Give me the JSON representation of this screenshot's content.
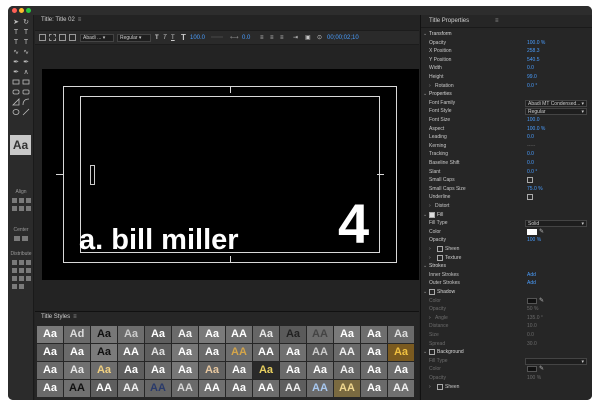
{
  "title_panel": {
    "tab_label": "Title: Title 02"
  },
  "toolbar": {
    "font_family": "Abadi ...",
    "font_style": "Regular",
    "size_glyph_small": "T",
    "size_glyph": "T",
    "font_size": "100.0",
    "tracking": "0.0",
    "timecode": "00;00;02;10"
  },
  "canvas": {
    "caption": "a. bill miller",
    "number": "4"
  },
  "tools": {
    "aa_label": "Aa",
    "align_label": "Align",
    "center_label": "Center",
    "distribute_label": "Distribute"
  },
  "styles": {
    "tab_label": "Title Styles",
    "swatches": [
      {
        "text": "Aa",
        "bg": "#7a7a7a",
        "fg": "#ffffff"
      },
      {
        "text": "Ad",
        "bg": "#6a6a6a",
        "fg": "#dddddd"
      },
      {
        "text": "Aa",
        "bg": "#777777",
        "fg": "#111111"
      },
      {
        "text": "Aa",
        "bg": "#6d6d6d",
        "fg": "#cccccc"
      },
      {
        "text": "Aa",
        "bg": "#5e5e5e",
        "fg": "#ffffff"
      },
      {
        "text": "Aa",
        "bg": "#6a6a6a",
        "fg": "#f5f5f5"
      },
      {
        "text": "Aa",
        "bg": "#7a7a7a",
        "fg": "#ffffff"
      },
      {
        "text": "AA",
        "bg": "#707070",
        "fg": "#ffffff"
      },
      {
        "text": "Aa",
        "bg": "#666666",
        "fg": "#e8e8e8"
      },
      {
        "text": "Aa",
        "bg": "#5a5a5a",
        "fg": "#222222"
      },
      {
        "text": "AA",
        "bg": "#6d6d6d",
        "fg": "#444444"
      },
      {
        "text": "Aa",
        "bg": "#7a7a7a",
        "fg": "#ffffff"
      },
      {
        "text": "Aa",
        "bg": "#6e6e6e",
        "fg": "#ffffff"
      },
      {
        "text": "Aa",
        "bg": "#6a6a6a",
        "fg": "#dddddd"
      },
      {
        "text": "Aa",
        "bg": "#5a5a5a",
        "fg": "#ffffff"
      },
      {
        "text": "Aa",
        "bg": "#6a6a6a",
        "fg": "#ffffff"
      },
      {
        "text": "Aa",
        "bg": "#7b7b7b",
        "fg": "#111111"
      },
      {
        "text": "AA",
        "bg": "#6a6a6a",
        "fg": "#ffffff"
      },
      {
        "text": "Aa",
        "bg": "#5e5e5e",
        "fg": "#e0e0e0"
      },
      {
        "text": "Aa",
        "bg": "#777777",
        "fg": "#ffffff"
      },
      {
        "text": "Aa",
        "bg": "#6a6a6a",
        "fg": "#ffffff"
      },
      {
        "text": "AA",
        "bg": "#6e6e6e",
        "fg": "#d4a54a"
      },
      {
        "text": "AA",
        "bg": "#666666",
        "fg": "#ffffff"
      },
      {
        "text": "Aa",
        "bg": "#707070",
        "fg": "#ffffff"
      },
      {
        "text": "AA",
        "bg": "#5d5d5d",
        "fg": "#cccccc"
      },
      {
        "text": "AA",
        "bg": "#6a6a6a",
        "fg": "#eeeeee"
      },
      {
        "text": "Aa",
        "bg": "#6a6a6a",
        "fg": "#ffffff"
      },
      {
        "text": "Aa",
        "bg": "#7a5a20",
        "fg": "#f0c040"
      },
      {
        "text": "Aa",
        "bg": "#6a6a6a",
        "fg": "#ffffff"
      },
      {
        "text": "Aa",
        "bg": "#707070",
        "fg": "#e8e8e8"
      },
      {
        "text": "Aa",
        "bg": "#6d6d6d",
        "fg": "#f0d080"
      },
      {
        "text": "Aa",
        "bg": "#5e5e5e",
        "fg": "#ffffff"
      },
      {
        "text": "Aa",
        "bg": "#6a6a6a",
        "fg": "#ffffff"
      },
      {
        "text": "Aa",
        "bg": "#777777",
        "fg": "#ffffff"
      },
      {
        "text": "Aa",
        "bg": "#606060",
        "fg": "#e8c8a0"
      },
      {
        "text": "Aa",
        "bg": "#6d6d6d",
        "fg": "#ffffff"
      },
      {
        "text": "Aa",
        "bg": "#2a2a2a",
        "fg": "#e8d060"
      },
      {
        "text": "Aa",
        "bg": "#6a6a6a",
        "fg": "#ffffff"
      },
      {
        "text": "Aa",
        "bg": "#707070",
        "fg": "#ffffff"
      },
      {
        "text": "Aa",
        "bg": "#666666",
        "fg": "#f0f0f0"
      },
      {
        "text": "Aa",
        "bg": "#6a6a6a",
        "fg": "#ffffff"
      },
      {
        "text": "Aa",
        "bg": "#6d6d6d",
        "fg": "#ffffff"
      },
      {
        "text": "Aa",
        "bg": "#6a6a6a",
        "fg": "#ffffff"
      },
      {
        "text": "AA",
        "bg": "#707070",
        "fg": "#111111"
      },
      {
        "text": "AA",
        "bg": "#5e5e5e",
        "fg": "#ffffff"
      },
      {
        "text": "AA",
        "bg": "#6a6a6a",
        "fg": "#f0f0f0"
      },
      {
        "text": "AA",
        "bg": "#666666",
        "fg": "#2a3a6a"
      },
      {
        "text": "AA",
        "bg": "#6a6a6a",
        "fg": "#d8d8d8"
      },
      {
        "text": "AA",
        "bg": "#707070",
        "fg": "#ffffff"
      },
      {
        "text": "Aa",
        "bg": "#6a6a6a",
        "fg": "#ffffff"
      },
      {
        "text": "AA",
        "bg": "#6d6d6d",
        "fg": "#ffffff"
      },
      {
        "text": "AA",
        "bg": "#5e5e5e",
        "fg": "#eeeeee"
      },
      {
        "text": "AA",
        "bg": "#6a6a6a",
        "fg": "#a8c8f0"
      },
      {
        "text": "AA",
        "bg": "#7a6a40",
        "fg": "#f0d890"
      },
      {
        "text": "Aa",
        "bg": "#6a6a6a",
        "fg": "#ffffff"
      },
      {
        "text": "AA",
        "bg": "#707070",
        "fg": "#f0f0f0"
      }
    ]
  },
  "properties": {
    "title": "Title Properties",
    "rows": [
      {
        "kind": "section",
        "label": "Transform",
        "chev": "⌄"
      },
      {
        "kind": "value",
        "label": "Opacity",
        "value": "100.0 %"
      },
      {
        "kind": "value",
        "label": "X Position",
        "value": "258.3"
      },
      {
        "kind": "value",
        "label": "Y Position",
        "value": "540.5"
      },
      {
        "kind": "value",
        "label": "Width",
        "value": "0.0"
      },
      {
        "kind": "value",
        "label": "Height",
        "value": "99.0"
      },
      {
        "kind": "value",
        "label": "Rotation",
        "value": "0.0 °",
        "chev": "›"
      },
      {
        "kind": "section",
        "label": "Properties",
        "chev": "⌄"
      },
      {
        "kind": "select",
        "label": "Font Family",
        "value": "Abadi MT Condensed..."
      },
      {
        "kind": "select",
        "label": "Font Style",
        "value": "Regular"
      },
      {
        "kind": "value",
        "label": "Font Size",
        "value": "100.0"
      },
      {
        "kind": "value",
        "label": "Aspect",
        "value": "100.0 %"
      },
      {
        "kind": "value",
        "label": "Leading",
        "value": "0.0"
      },
      {
        "kind": "dim",
        "label": "Kerning",
        "value": "-----"
      },
      {
        "kind": "value",
        "label": "Tracking",
        "value": "0.0"
      },
      {
        "kind": "value",
        "label": "Baseline Shift",
        "value": "0.0"
      },
      {
        "kind": "value",
        "label": "Slant",
        "value": "0.0 °"
      },
      {
        "kind": "check",
        "label": "Small Caps",
        "checked": false
      },
      {
        "kind": "value",
        "label": "Small Caps Size",
        "value": "75.0 %"
      },
      {
        "kind": "check",
        "label": "Underline",
        "checked": false
      },
      {
        "kind": "plain",
        "label": "Distort",
        "chev": "›"
      },
      {
        "kind": "sectioncheck",
        "label": "Fill",
        "chev": "⌄",
        "checked": true
      },
      {
        "kind": "select",
        "label": "Fill Type",
        "value": "Solid"
      },
      {
        "kind": "color",
        "label": "Color",
        "color": "#ffffff"
      },
      {
        "kind": "value",
        "label": "Opacity",
        "value": "100 %"
      },
      {
        "kind": "subcheck",
        "label": "Sheen",
        "chev": "›",
        "checked": false
      },
      {
        "kind": "subcheck",
        "label": "Texture",
        "chev": "›",
        "checked": false
      },
      {
        "kind": "section",
        "label": "Strokes",
        "chev": "⌄"
      },
      {
        "kind": "add",
        "label": "Inner Strokes",
        "add": "Add"
      },
      {
        "kind": "add",
        "label": "Outer Strokes",
        "add": "Add"
      },
      {
        "kind": "sectioncheck",
        "label": "Shadow",
        "chev": "⌄",
        "checked": false
      },
      {
        "kind": "colordim",
        "label": "Color",
        "color": "#111111"
      },
      {
        "kind": "dimval",
        "label": "Opacity",
        "value": "50 %"
      },
      {
        "kind": "dimval",
        "label": "Angle",
        "value": "135.0 °",
        "chev": "›"
      },
      {
        "kind": "dimval",
        "label": "Distance",
        "value": "10.0"
      },
      {
        "kind": "dimval",
        "label": "Size",
        "value": "0.0"
      },
      {
        "kind": "dimval",
        "label": "Spread",
        "value": "30.0"
      },
      {
        "kind": "sectioncheck",
        "label": "Background",
        "chev": "⌄",
        "checked": false
      },
      {
        "kind": "dimselect",
        "label": "Fill Type",
        "value": ""
      },
      {
        "kind": "colordim",
        "label": "Color",
        "color": "#111111"
      },
      {
        "kind": "dimval",
        "label": "Opacity",
        "value": "100 %"
      },
      {
        "kind": "subcheck",
        "label": "Sheen",
        "chev": "›",
        "checked": false
      }
    ]
  },
  "colors": {
    "accent": "#4a9eff",
    "panel_bg": "#232323",
    "canvas_bg": "#000000"
  }
}
